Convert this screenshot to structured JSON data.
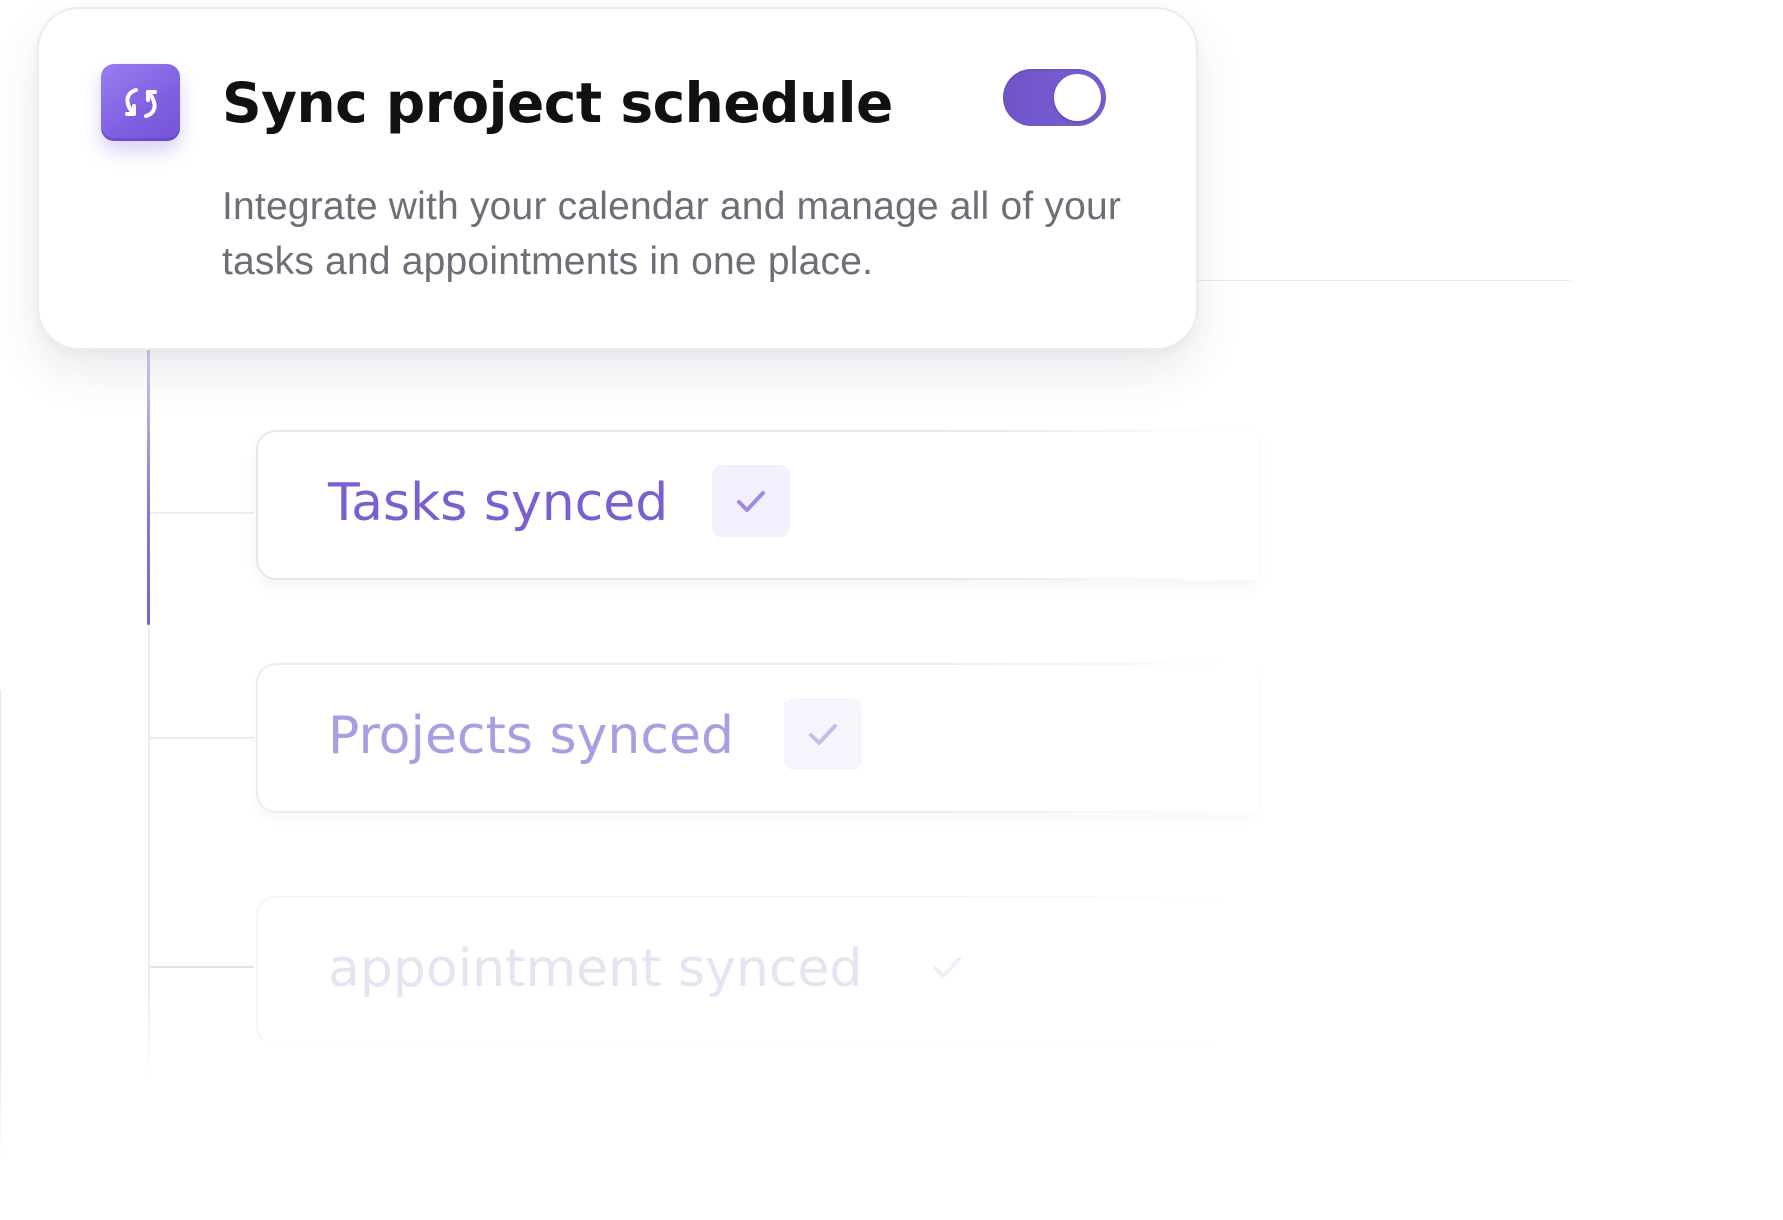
{
  "header": {
    "icon": "sync-icon",
    "title": "Sync project schedule",
    "description": "Integrate with your calendar and manage all of your tasks and appointments in one place.",
    "toggle_on": true
  },
  "sync_items": [
    {
      "label": "Tasks synced",
      "icon": "check-icon"
    },
    {
      "label": "Projects synced",
      "icon": "check-icon"
    },
    {
      "label": "appointment synced",
      "icon": "check-icon"
    }
  ],
  "colors": {
    "accent": "#7b5fd4",
    "icon_bg": "#8a6ae8",
    "title": "#111114",
    "description": "#6e6e78",
    "check_bg": "#f3f0fd"
  }
}
